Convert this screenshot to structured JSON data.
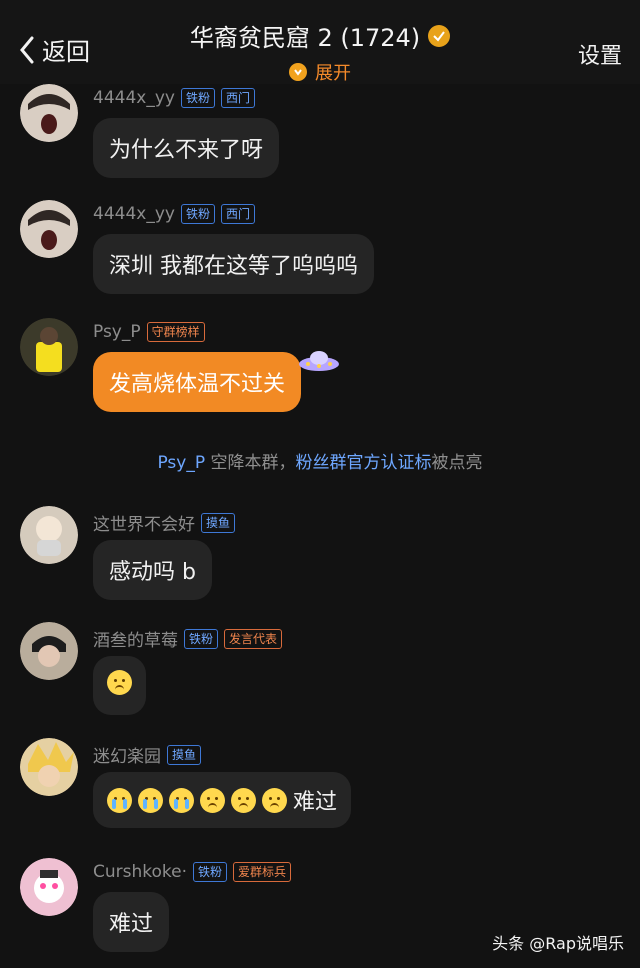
{
  "header": {
    "back_label": "返回",
    "title": "华裔贫民窟 2 (1724)",
    "expand_label": "展开",
    "settings_label": "设置"
  },
  "messages": [
    {
      "name": "4444x_yy",
      "tags": [
        "铁粉",
        "西门"
      ],
      "text": "为什么不来了呀"
    },
    {
      "name": "4444x_yy",
      "tags": [
        "铁粉",
        "西门"
      ],
      "text": "深圳 我都在这等了呜呜呜"
    },
    {
      "name": "Psy_P",
      "tags": [
        "守群榜样"
      ],
      "text": "发高烧体温不过关"
    },
    {
      "name": "这世界不会好",
      "tags": [
        "摸鱼"
      ],
      "text": "感动吗 b"
    },
    {
      "name": "酒叁的草莓",
      "tags": [
        "铁粉",
        "发言代表"
      ],
      "text": ""
    },
    {
      "name": "迷幻楽园",
      "tags": [
        "摸鱼"
      ],
      "text": "难过"
    },
    {
      "name": "Curshkoke·",
      "tags": [
        "铁粉",
        "爱群标兵"
      ],
      "text": "难过"
    }
  ],
  "system": {
    "name": "Psy_P",
    "text": " 空降本群，",
    "highlight": "粉丝群官方认证标",
    "suffix": "被点亮"
  },
  "watermark": "头条 @Rap说唱乐",
  "colors": {
    "background": "#121212",
    "bubble": "#252525",
    "accent_orange": "#f28a24",
    "tag_blue": "#6fa7ff",
    "tag_orange": "#f0854d"
  }
}
